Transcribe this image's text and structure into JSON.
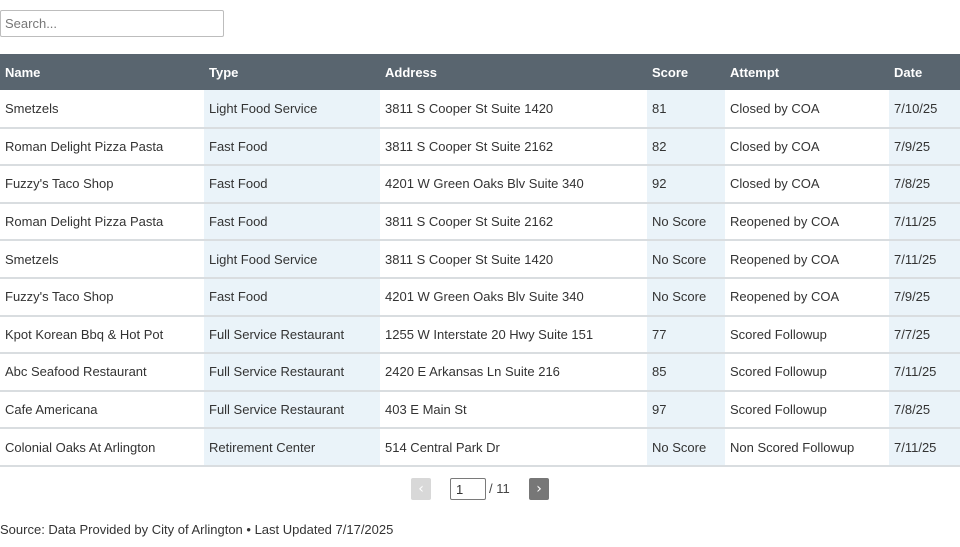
{
  "search": {
    "placeholder": "Search...",
    "value": ""
  },
  "table": {
    "columns": [
      "Name",
      "Type",
      "Address",
      "Score",
      "Attempt",
      "Date"
    ],
    "rows": [
      [
        "Smetzels",
        "Light Food Service",
        "3811 S Cooper St Suite 1420",
        "81",
        "Closed by COA",
        "7/10/25"
      ],
      [
        "Roman Delight Pizza Pasta",
        "Fast Food",
        "3811 S Cooper St Suite 2162",
        "82",
        "Closed by COA",
        "7/9/25"
      ],
      [
        "Fuzzy's Taco Shop",
        "Fast Food",
        "4201 W Green Oaks Blv Suite 340",
        "92",
        "Closed by COA",
        "7/8/25"
      ],
      [
        "Roman Delight Pizza Pasta",
        "Fast Food",
        "3811 S Cooper St Suite 2162",
        "No Score",
        "Reopened by COA",
        "7/11/25"
      ],
      [
        "Smetzels",
        "Light Food Service",
        "3811 S Cooper St Suite 1420",
        "No Score",
        "Reopened by COA",
        "7/11/25"
      ],
      [
        "Fuzzy's Taco Shop",
        "Fast Food",
        "4201 W Green Oaks Blv Suite 340",
        "No Score",
        "Reopened by COA",
        "7/9/25"
      ],
      [
        "Kpot Korean Bbq & Hot Pot",
        "Full Service Restaurant",
        "1255 W Interstate 20 Hwy Suite 151",
        "77",
        "Scored Followup",
        "7/7/25"
      ],
      [
        "Abc Seafood Restaurant",
        "Full Service Restaurant",
        "2420 E Arkansas Ln Suite 216",
        "85",
        "Scored Followup",
        "7/11/25"
      ],
      [
        "Cafe Americana",
        "Full Service Restaurant",
        "403 E Main St",
        "97",
        "Scored Followup",
        "7/8/25"
      ],
      [
        "Colonial Oaks At Arlington",
        "Retirement Center",
        "514 Central Park Dr",
        "No Score",
        "Non Scored Followup",
        "7/11/25"
      ]
    ]
  },
  "pagination": {
    "prev_label": "‹",
    "next_label": "›",
    "current_page": "1",
    "total_label": "/ 11"
  },
  "footer": {
    "source_text": "Source: Data Provided by City of Arlington • Last Updated 7/17/2025"
  },
  "colors": {
    "header_bg": "#59656f",
    "alt_column_bg": "#eaf3f9",
    "row_divider": "#d9dde0",
    "pager_active": "#777777",
    "pager_disabled": "#d8d8d8"
  }
}
